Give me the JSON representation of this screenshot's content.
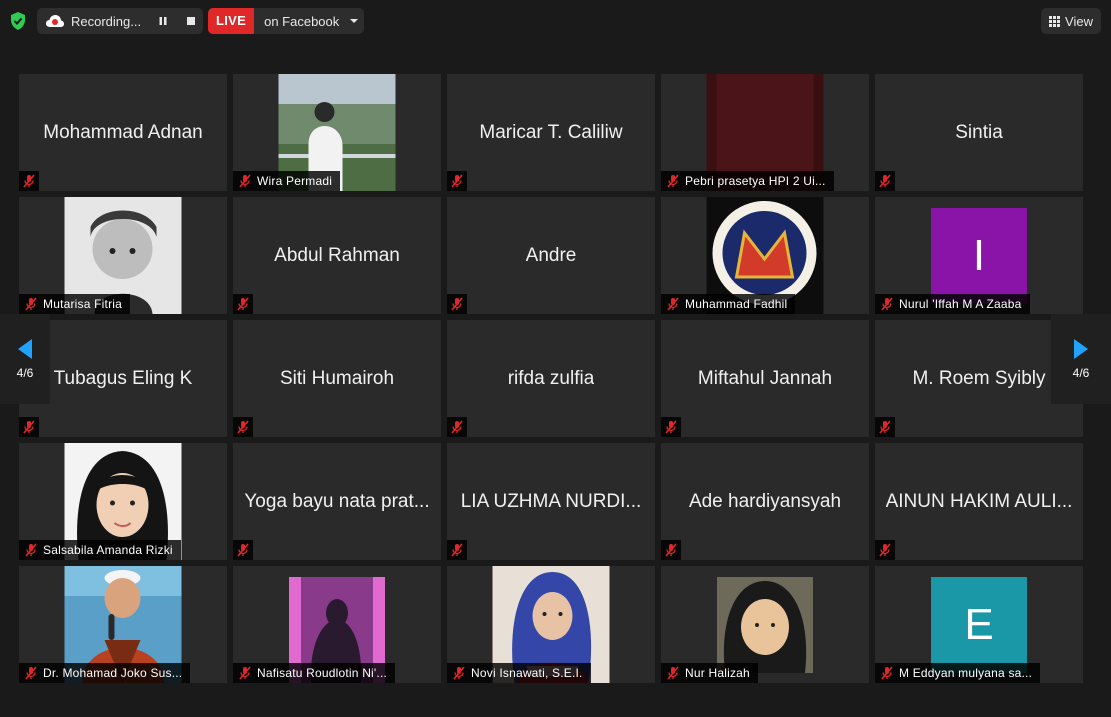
{
  "toolbar": {
    "recording_label": "Recording...",
    "live_badge": "LIVE",
    "live_target": "on Facebook",
    "view_label": "View"
  },
  "pager": {
    "left_label": "4/6",
    "right_label": "4/6"
  },
  "tiles": [
    {
      "big": "Mohammad Adnan"
    },
    {
      "name": "Wira Permadi"
    },
    {
      "big": "Maricar T. Caliliw"
    },
    {
      "name": "Pebri prasetya HPI 2 Ui..."
    },
    {
      "big": "Sintia"
    },
    {
      "name": "Mutarisa Fitria"
    },
    {
      "big": "Abdul Rahman"
    },
    {
      "big": "Andre"
    },
    {
      "name": "Muhammad Fadhil"
    },
    {
      "name": "Nurul 'Iffah M A Zaaba",
      "letter": "I"
    },
    {
      "big": "Tubagus Eling K"
    },
    {
      "big": "Siti Humairoh"
    },
    {
      "big": "rifda zulfia"
    },
    {
      "big": "Miftahul Jannah"
    },
    {
      "big": "M. Roem Syibly"
    },
    {
      "name": "Salsabila Amanda Rizki"
    },
    {
      "big": "Yoga bayu nata prat..."
    },
    {
      "big": "LIA UZHMA NURDI..."
    },
    {
      "big": "Ade hardiyansyah"
    },
    {
      "big": "AINUN HAKIM AULI..."
    },
    {
      "name": "Dr. Mohamad Joko Sus..."
    },
    {
      "name": "Nafisatu Roudlotin Ni'..."
    },
    {
      "name": "Novi Isnawati, S.E.I."
    },
    {
      "name": "Nur Halizah"
    },
    {
      "name": "M Eddyan mulyana  sa...",
      "letter": "E"
    }
  ],
  "colors": {
    "live": "#e02828",
    "mute": "#e02828",
    "avatar_i": "#8a14a8",
    "avatar_e": "#1a98a8",
    "shield": "#2ecc52"
  }
}
